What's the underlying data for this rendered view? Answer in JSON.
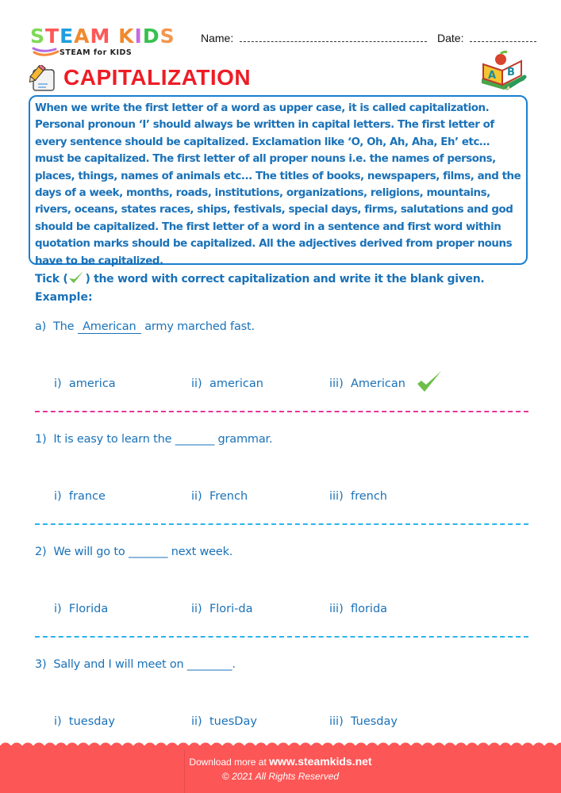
{
  "header": {
    "logo": {
      "letters": [
        "S",
        "T",
        "E",
        "A",
        "M",
        " ",
        "K",
        "I",
        "D",
        "S"
      ],
      "letter_colors": [
        "#7ed957",
        "#ff5757",
        "#1e9ee0",
        "#f08a2e",
        "#ffffff",
        "#ffffff",
        "#c66ae0",
        "#c66ae0",
        "#35c14d",
        "#f4964f"
      ],
      "subtitle": "STEAM for KIDS"
    },
    "name_label": "Name:",
    "date_label": "Date:"
  },
  "title": {
    "text": "CAPITALIZATION",
    "color": "#ee1c25"
  },
  "info": {
    "text": "When we write the first letter of a word as upper case, it is called capitalization. Personal pronoun ‘I’ should always be written in capital letters. The first letter of every sentence should be capitalized. Exclamation like ‘O, Oh, Ah, Aha, Eh’ etc… must be capitalized. The first letter of all proper nouns i.e. the names of persons, places, things, names of animals etc... The titles of books, newspapers, films, and the days of a week, months, roads, institutions, organizations, religions, mountains, rivers, oceans, states races, ships, festivals, special days, firms, salutations and god should be capitalized. The first letter of a word in a sentence and first word within quotation marks should be capitalized. All the adjectives derived from proper nouns have to be capitalized.",
    "border_color": "#1a7fd0"
  },
  "instructions": {
    "prefix": "Tick (",
    "suffix": ") the word with correct capitalization and write it the blank given.",
    "example_label": "Example:"
  },
  "example": {
    "number": "a)",
    "before": "The",
    "answer": "American",
    "after": "army marched fast.",
    "options": [
      {
        "num": "i)",
        "text": "america"
      },
      {
        "num": "ii)",
        "text": "american"
      },
      {
        "num": "iii)",
        "text": "American"
      }
    ],
    "checked_index": 2
  },
  "questions": [
    {
      "number": "1)",
      "before": "It is easy to learn the",
      "blank": "_______",
      "after": "grammar.",
      "options": [
        {
          "num": "i)",
          "text": "france"
        },
        {
          "num": "ii)",
          "text": "French"
        },
        {
          "num": "iii)",
          "text": "french"
        }
      ]
    },
    {
      "number": "2)",
      "before": "We will go to",
      "blank": "_______",
      "after": "next week.",
      "options": [
        {
          "num": "i)",
          "text": "Florida"
        },
        {
          "num": "ii)",
          "text": "Flori-da"
        },
        {
          "num": "iii)",
          "text": "florida"
        }
      ]
    },
    {
      "number": "3)",
      "before": "Sally and I will meet on",
      "blank": "________",
      "after": ".",
      "options": [
        {
          "num": "i)",
          "text": "tuesday"
        },
        {
          "num": "ii)",
          "text": "tuesDay"
        },
        {
          "num": "iii)",
          "text": "Tuesday"
        }
      ]
    }
  ],
  "colors": {
    "text_blue": "#1a72b8",
    "separator_pink": "#e8349a",
    "separator_blue": "#2ab4ec",
    "check_green": "#6cc04a",
    "footer_red": "#fd5656"
  },
  "footer": {
    "download_text": "Download more at",
    "url": "www.steamkids.net",
    "copyright": "© 2021 All Rights Reserved"
  }
}
